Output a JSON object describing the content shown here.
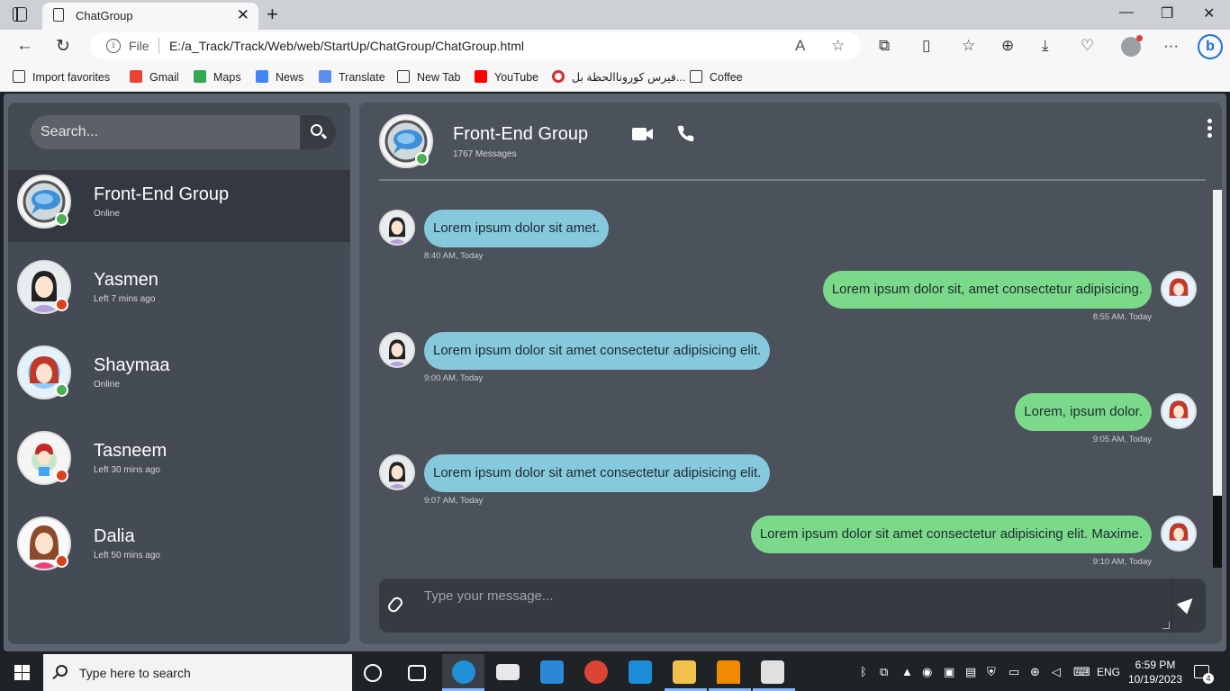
{
  "browser": {
    "tab_title": "ChatGroup",
    "file_label": "File",
    "url": "E:/a_Track/Track/Web/web/StartUp/ChatGroup/ChatGroup.html"
  },
  "favorites": [
    {
      "label": "Import favorites",
      "icon": "import-icon"
    },
    {
      "label": "Gmail",
      "icon": "gmail-icon"
    },
    {
      "label": "Maps",
      "icon": "maps-icon"
    },
    {
      "label": "News",
      "icon": "news-icon"
    },
    {
      "label": "Translate",
      "icon": "translate-icon"
    },
    {
      "label": "New Tab",
      "icon": "page-icon"
    },
    {
      "label": "YouTube",
      "icon": "youtube-icon"
    },
    {
      "label": "فيرس كوروناالحظة بل...",
      "icon": "target-icon"
    },
    {
      "label": "Coffee",
      "icon": "page-icon"
    }
  ],
  "sidebar": {
    "search_placeholder": "Search...",
    "contacts": [
      {
        "name": "Front-End Group",
        "status": "Online",
        "online": true
      },
      {
        "name": "Yasmen",
        "status": "Left 7 mins ago",
        "online": false
      },
      {
        "name": "Shaymaa",
        "status": "Online",
        "online": true
      },
      {
        "name": "Tasneem",
        "status": "Left 30 mins ago",
        "online": false
      },
      {
        "name": "Dalia",
        "status": "Left 50 mins ago",
        "online": false
      }
    ]
  },
  "chat": {
    "group_name": "Front-End Group",
    "message_count": "1767 Messages",
    "messages": [
      {
        "text": "Lorem ipsum dolor sit amet.",
        "time": "8:40 AM, Today",
        "direction": "in"
      },
      {
        "text": "Lorem ipsum dolor sit, amet consectetur adipisicing.",
        "time": "8:55 AM, Today",
        "direction": "out"
      },
      {
        "text": "Lorem ipsum dolor sit amet consectetur adipisicing elit.",
        "time": "9:00 AM, Today",
        "direction": "in"
      },
      {
        "text": "Lorem, ipsum dolor.",
        "time": "9:05 AM, Today",
        "direction": "out"
      },
      {
        "text": "Lorem ipsum dolor sit amet consectetur adipisicing elit.",
        "time": "9:07 AM, Today",
        "direction": "in"
      },
      {
        "text": "Lorem ipsum dolor sit amet consectetur adipisicing elit. Maxime.",
        "time": "9:10 AM, Today",
        "direction": "out"
      }
    ],
    "composer_placeholder": "Type your message..."
  },
  "taskbar": {
    "search_text": "Type here to search",
    "language": "ENG",
    "time": "6:59 PM",
    "date": "10/19/2023",
    "notification_count": "4"
  },
  "colors": {
    "online": "#4caf50",
    "offline": "#d9411e",
    "incoming_bubble": "#86c8dc",
    "outgoing_bubble": "#7bd98a"
  }
}
